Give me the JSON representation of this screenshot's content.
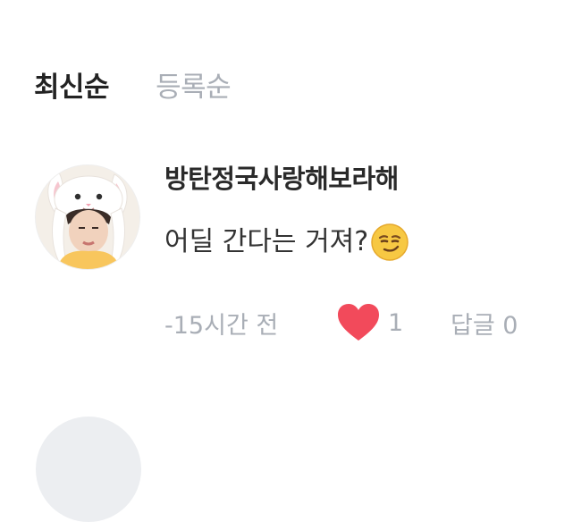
{
  "sort": {
    "latest_label": "최신순",
    "registered_label": "등록순",
    "active": "latest"
  },
  "comment": {
    "username": "방탄정국사랑해보라해",
    "text": "어딜 간다는 거져?",
    "emoji_icon": "smirking-face-icon",
    "time": "-15시간 전",
    "like_count": "1",
    "reply_label": "답글 0",
    "heart_color": "#f24a5b"
  }
}
